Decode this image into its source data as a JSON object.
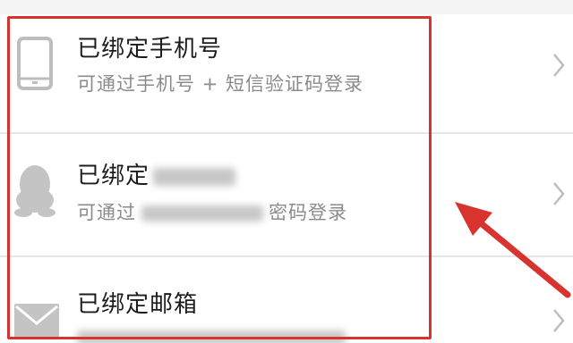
{
  "accounts": [
    {
      "title": "已绑定手机号",
      "subtitle": "可通过手机号 + 短信验证码登录",
      "icon": "phone-icon"
    },
    {
      "title": "已绑定",
      "subtitle_prefix": "可通过",
      "subtitle_suffix": "密码登录",
      "icon": "qq-icon"
    },
    {
      "title": "已绑定邮箱",
      "icon": "mail-icon"
    }
  ],
  "colors": {
    "highlight": "#d9332f",
    "title": "#1c1c1c",
    "subtitle": "#8b8b8b",
    "chevron": "#bdbdbd"
  }
}
